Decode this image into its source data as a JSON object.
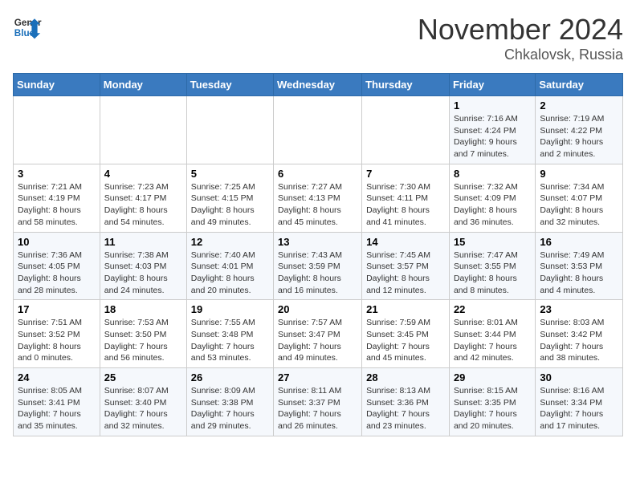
{
  "logo": {
    "general": "General",
    "blue": "Blue"
  },
  "title": "November 2024",
  "location": "Chkalovsk, Russia",
  "weekdays": [
    "Sunday",
    "Monday",
    "Tuesday",
    "Wednesday",
    "Thursday",
    "Friday",
    "Saturday"
  ],
  "weeks": [
    [
      {
        "day": "",
        "sunrise": "",
        "sunset": "",
        "daylight": ""
      },
      {
        "day": "",
        "sunrise": "",
        "sunset": "",
        "daylight": ""
      },
      {
        "day": "",
        "sunrise": "",
        "sunset": "",
        "daylight": ""
      },
      {
        "day": "",
        "sunrise": "",
        "sunset": "",
        "daylight": ""
      },
      {
        "day": "",
        "sunrise": "",
        "sunset": "",
        "daylight": ""
      },
      {
        "day": "1",
        "sunrise": "Sunrise: 7:16 AM",
        "sunset": "Sunset: 4:24 PM",
        "daylight": "Daylight: 9 hours and 7 minutes."
      },
      {
        "day": "2",
        "sunrise": "Sunrise: 7:19 AM",
        "sunset": "Sunset: 4:22 PM",
        "daylight": "Daylight: 9 hours and 2 minutes."
      }
    ],
    [
      {
        "day": "3",
        "sunrise": "Sunrise: 7:21 AM",
        "sunset": "Sunset: 4:19 PM",
        "daylight": "Daylight: 8 hours and 58 minutes."
      },
      {
        "day": "4",
        "sunrise": "Sunrise: 7:23 AM",
        "sunset": "Sunset: 4:17 PM",
        "daylight": "Daylight: 8 hours and 54 minutes."
      },
      {
        "day": "5",
        "sunrise": "Sunrise: 7:25 AM",
        "sunset": "Sunset: 4:15 PM",
        "daylight": "Daylight: 8 hours and 49 minutes."
      },
      {
        "day": "6",
        "sunrise": "Sunrise: 7:27 AM",
        "sunset": "Sunset: 4:13 PM",
        "daylight": "Daylight: 8 hours and 45 minutes."
      },
      {
        "day": "7",
        "sunrise": "Sunrise: 7:30 AM",
        "sunset": "Sunset: 4:11 PM",
        "daylight": "Daylight: 8 hours and 41 minutes."
      },
      {
        "day": "8",
        "sunrise": "Sunrise: 7:32 AM",
        "sunset": "Sunset: 4:09 PM",
        "daylight": "Daylight: 8 hours and 36 minutes."
      },
      {
        "day": "9",
        "sunrise": "Sunrise: 7:34 AM",
        "sunset": "Sunset: 4:07 PM",
        "daylight": "Daylight: 8 hours and 32 minutes."
      }
    ],
    [
      {
        "day": "10",
        "sunrise": "Sunrise: 7:36 AM",
        "sunset": "Sunset: 4:05 PM",
        "daylight": "Daylight: 8 hours and 28 minutes."
      },
      {
        "day": "11",
        "sunrise": "Sunrise: 7:38 AM",
        "sunset": "Sunset: 4:03 PM",
        "daylight": "Daylight: 8 hours and 24 minutes."
      },
      {
        "day": "12",
        "sunrise": "Sunrise: 7:40 AM",
        "sunset": "Sunset: 4:01 PM",
        "daylight": "Daylight: 8 hours and 20 minutes."
      },
      {
        "day": "13",
        "sunrise": "Sunrise: 7:43 AM",
        "sunset": "Sunset: 3:59 PM",
        "daylight": "Daylight: 8 hours and 16 minutes."
      },
      {
        "day": "14",
        "sunrise": "Sunrise: 7:45 AM",
        "sunset": "Sunset: 3:57 PM",
        "daylight": "Daylight: 8 hours and 12 minutes."
      },
      {
        "day": "15",
        "sunrise": "Sunrise: 7:47 AM",
        "sunset": "Sunset: 3:55 PM",
        "daylight": "Daylight: 8 hours and 8 minutes."
      },
      {
        "day": "16",
        "sunrise": "Sunrise: 7:49 AM",
        "sunset": "Sunset: 3:53 PM",
        "daylight": "Daylight: 8 hours and 4 minutes."
      }
    ],
    [
      {
        "day": "17",
        "sunrise": "Sunrise: 7:51 AM",
        "sunset": "Sunset: 3:52 PM",
        "daylight": "Daylight: 8 hours and 0 minutes."
      },
      {
        "day": "18",
        "sunrise": "Sunrise: 7:53 AM",
        "sunset": "Sunset: 3:50 PM",
        "daylight": "Daylight: 7 hours and 56 minutes."
      },
      {
        "day": "19",
        "sunrise": "Sunrise: 7:55 AM",
        "sunset": "Sunset: 3:48 PM",
        "daylight": "Daylight: 7 hours and 53 minutes."
      },
      {
        "day": "20",
        "sunrise": "Sunrise: 7:57 AM",
        "sunset": "Sunset: 3:47 PM",
        "daylight": "Daylight: 7 hours and 49 minutes."
      },
      {
        "day": "21",
        "sunrise": "Sunrise: 7:59 AM",
        "sunset": "Sunset: 3:45 PM",
        "daylight": "Daylight: 7 hours and 45 minutes."
      },
      {
        "day": "22",
        "sunrise": "Sunrise: 8:01 AM",
        "sunset": "Sunset: 3:44 PM",
        "daylight": "Daylight: 7 hours and 42 minutes."
      },
      {
        "day": "23",
        "sunrise": "Sunrise: 8:03 AM",
        "sunset": "Sunset: 3:42 PM",
        "daylight": "Daylight: 7 hours and 38 minutes."
      }
    ],
    [
      {
        "day": "24",
        "sunrise": "Sunrise: 8:05 AM",
        "sunset": "Sunset: 3:41 PM",
        "daylight": "Daylight: 7 hours and 35 minutes."
      },
      {
        "day": "25",
        "sunrise": "Sunrise: 8:07 AM",
        "sunset": "Sunset: 3:40 PM",
        "daylight": "Daylight: 7 hours and 32 minutes."
      },
      {
        "day": "26",
        "sunrise": "Sunrise: 8:09 AM",
        "sunset": "Sunset: 3:38 PM",
        "daylight": "Daylight: 7 hours and 29 minutes."
      },
      {
        "day": "27",
        "sunrise": "Sunrise: 8:11 AM",
        "sunset": "Sunset: 3:37 PM",
        "daylight": "Daylight: 7 hours and 26 minutes."
      },
      {
        "day": "28",
        "sunrise": "Sunrise: 8:13 AM",
        "sunset": "Sunset: 3:36 PM",
        "daylight": "Daylight: 7 hours and 23 minutes."
      },
      {
        "day": "29",
        "sunrise": "Sunrise: 8:15 AM",
        "sunset": "Sunset: 3:35 PM",
        "daylight": "Daylight: 7 hours and 20 minutes."
      },
      {
        "day": "30",
        "sunrise": "Sunrise: 8:16 AM",
        "sunset": "Sunset: 3:34 PM",
        "daylight": "Daylight: 7 hours and 17 minutes."
      }
    ]
  ]
}
